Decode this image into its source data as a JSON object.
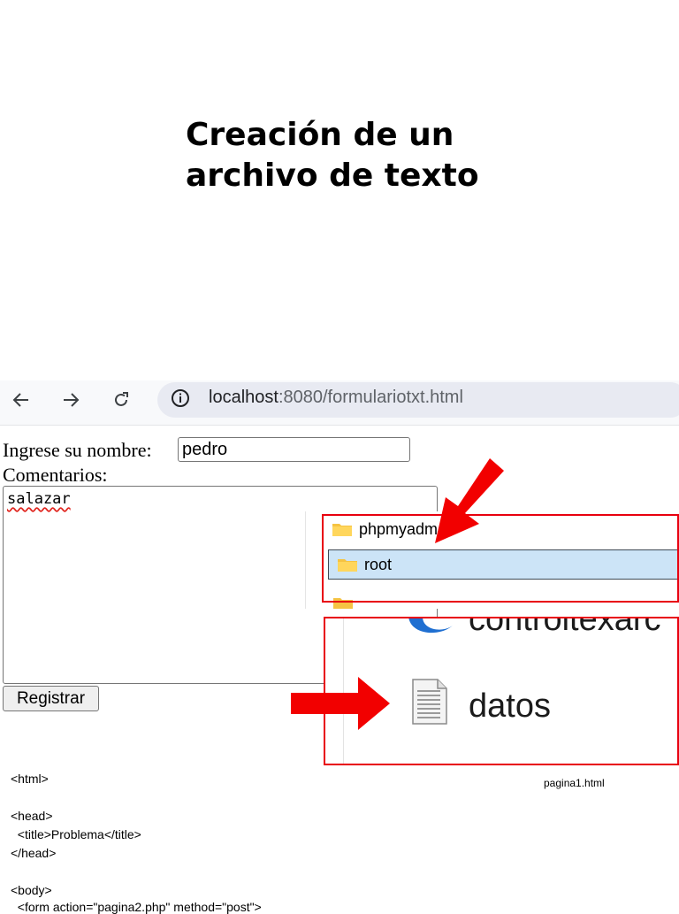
{
  "slide": {
    "title_line1": "Creación de un",
    "title_line2": "archivo de texto"
  },
  "browser": {
    "url_host": "localhost",
    "url_path": ":8080/formulariotxt.html",
    "back_icon": "arrow-left",
    "forward_icon": "arrow-right",
    "reload_icon": "reload",
    "info_icon": "info-circle"
  },
  "form": {
    "name_label": "Ingrese su nombre:",
    "name_value": "pedro",
    "comments_label": "Comentarios:",
    "comments_value": "salazar",
    "submit_label": "Registrar"
  },
  "explorer": {
    "folders": [
      {
        "label": "phpmyadm"
      },
      {
        "label": "root"
      }
    ],
    "partial_file_label": "controltexarc",
    "file_label": "datos"
  },
  "code": {
    "lines": [
      "<html>",
      "",
      "<head>",
      "  <title>Problema</title>",
      "</head>",
      "",
      "<body>",
      "  <form action=\"pagina2.php\" method=\"post\">"
    ]
  },
  "caption": "pagina1.html",
  "colors": {
    "highlight_red": "#e8000e",
    "selection_blue": "#cce4f7",
    "folder_yellow": "#f5c342"
  }
}
